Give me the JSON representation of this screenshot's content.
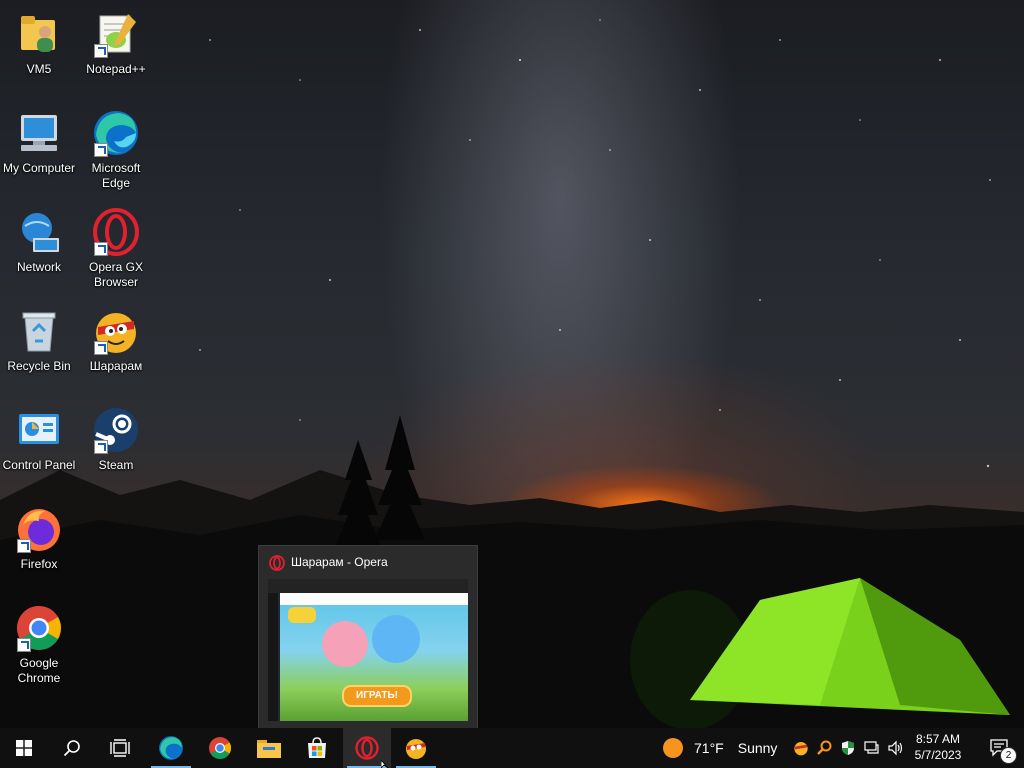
{
  "desktop": {
    "icons": [
      {
        "label": "VM5",
        "icon": "user-folder-icon"
      },
      {
        "label": "Notepad++",
        "icon": "notepadpp-icon"
      },
      {
        "label": "My Computer",
        "icon": "computer-icon"
      },
      {
        "label": "Microsoft Edge",
        "icon": "edge-icon"
      },
      {
        "label": "Network",
        "icon": "network-icon"
      },
      {
        "label": "Opera GX Browser",
        "icon": "opera-gx-icon"
      },
      {
        "label": "Recycle Bin",
        "icon": "recycle-bin-icon"
      },
      {
        "label": "Шарарам",
        "icon": "shararam-icon"
      },
      {
        "label": "Control Panel",
        "icon": "control-panel-icon"
      },
      {
        "label": "Steam",
        "icon": "steam-icon"
      },
      {
        "label": "Firefox",
        "icon": "firefox-icon"
      },
      {
        "label": "Google Chrome",
        "icon": "chrome-icon"
      }
    ]
  },
  "preview": {
    "title": "Шарарам - Opera",
    "play_label": "ИГРАТЬ!"
  },
  "taskbar": {
    "apps": [
      "start-icon",
      "search-icon",
      "task-view-icon",
      "edge-icon",
      "chrome-icon",
      "file-explorer-icon",
      "store-icon",
      "opera-icon",
      "shararam-icon"
    ],
    "weather": {
      "temp": "71°F",
      "condition": "Sunny"
    },
    "clock": {
      "time": "8:57 AM",
      "date": "5/7/2023"
    },
    "notifications_count": "2"
  },
  "colors": {
    "taskbar": "#101010",
    "accent": "#76b9ed",
    "opera_red": "#e0212f"
  }
}
